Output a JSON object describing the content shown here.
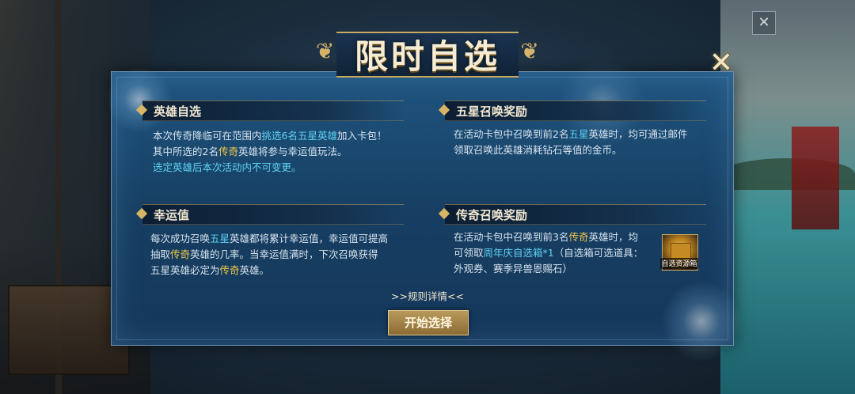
{
  "title": "限时自选",
  "close_icon": "close-x-icon",
  "top_right_icon": "close-x-icon",
  "sections": {
    "hero_select": {
      "title": "英雄自选",
      "line1": {
        "a": "本次传奇降临可在范围内",
        "b": "挑选6名五星英雄",
        "c": "加入卡包！"
      },
      "line2": {
        "a": "其中所选的2名",
        "b": "传奇",
        "c": "英雄将参与幸运值玩法。"
      },
      "line3": "选定英雄后本次活动内不可变更。"
    },
    "luck": {
      "title": "幸运值",
      "line1": {
        "a": "每次成功召唤",
        "b": "五星",
        "c": "英雄都将累计幸运值，幸运值可提高"
      },
      "line2": {
        "a": "抽取",
        "b": "传奇",
        "c": "英雄的几率。当幸运值满时，下次召唤获得"
      },
      "line3": {
        "a": "五星英雄必定为",
        "b": "传奇",
        "c": "英雄。"
      }
    },
    "five_star_reward": {
      "title": "五星召唤奖励",
      "line1": {
        "a": "在活动卡包中召唤到前2名",
        "b": "五星",
        "c": "英雄时，均可通过邮件"
      },
      "line2": "领取召唤此英雄消耗钻石等值的金币。"
    },
    "legend_reward": {
      "title": "传奇召唤奖励",
      "line1": {
        "a": "在活动卡包中召唤到前3名",
        "b": "传奇",
        "c": "英雄时，均"
      },
      "line2": {
        "a": "可领取",
        "b": "周年庆自选箱*1",
        "c": "（自选箱可选道具："
      },
      "line3": "外观券、赛季异兽恩赐石）",
      "item_label": "自选资源箱",
      "item_icon": "treasure-chest-icon"
    }
  },
  "rules_link": ">>规则详情<<",
  "start_button": "开始选择"
}
